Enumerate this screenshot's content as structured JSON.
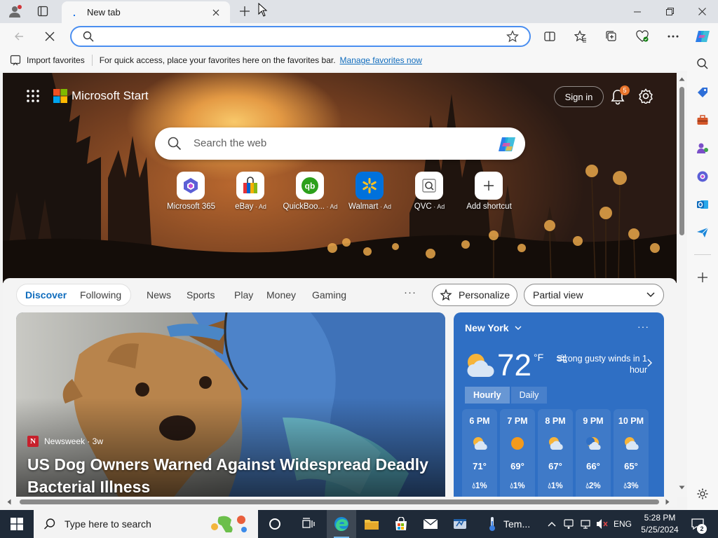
{
  "browser": {
    "tab": {
      "title": "New tab"
    },
    "address": {
      "value": "",
      "placeholder": ""
    },
    "window_controls": [
      "minimize",
      "restore",
      "close"
    ]
  },
  "favorites_bar": {
    "import_label": "Import favorites",
    "hint": "For quick access, place your favorites here on the favorites bar.",
    "manage_link": "Manage favorites now"
  },
  "start": {
    "brand": "Microsoft Start",
    "sign_in": "Sign in",
    "notifications_count": "5",
    "search_placeholder": "Search the web",
    "shortcuts": [
      {
        "label": "Microsoft 365",
        "ad": ""
      },
      {
        "label": "eBay",
        "ad": " · Ad"
      },
      {
        "label": "QuickBoo...",
        "ad": " · Ad"
      },
      {
        "label": "Walmart",
        "ad": " · Ad"
      },
      {
        "label": "QVC",
        "ad": " · Ad"
      },
      {
        "label": "Add shortcut",
        "ad": ""
      }
    ]
  },
  "feed": {
    "nav": [
      "Discover",
      "Following",
      "News",
      "Sports",
      "Play",
      "Money",
      "Gaming"
    ],
    "personalize": "Personalize",
    "view_select": "Partial view",
    "story": {
      "source": "Newsweek · 3w",
      "source_logo": "N",
      "headline": "US Dog Owners Warned Against Widespread Deadly Bacterial Illness"
    }
  },
  "weather": {
    "location": "New York",
    "temp": "72",
    "unit": "°F",
    "alert": "Strong gusty winds in 1 hour",
    "tabs": [
      "Hourly",
      "Daily"
    ],
    "hours": [
      {
        "time": "6 PM",
        "temp": "71°",
        "precip": "1%"
      },
      {
        "time": "7 PM",
        "temp": "69°",
        "precip": "1%"
      },
      {
        "time": "8 PM",
        "temp": "67°",
        "precip": "1%"
      },
      {
        "time": "9 PM",
        "temp": "66°",
        "precip": "2%"
      },
      {
        "time": "10 PM",
        "temp": "65°",
        "precip": "3%"
      }
    ]
  },
  "taskbar": {
    "search_placeholder": "Type here to search",
    "app_label": "Tem...",
    "language": "ENG",
    "time": "5:28 PM",
    "date": "5/25/2024",
    "notification_count": "2"
  },
  "colors": {
    "accent": "#0f6cbd",
    "weather_bg": "#2f6fc4",
    "taskbar_bg": "#1f2a38"
  }
}
